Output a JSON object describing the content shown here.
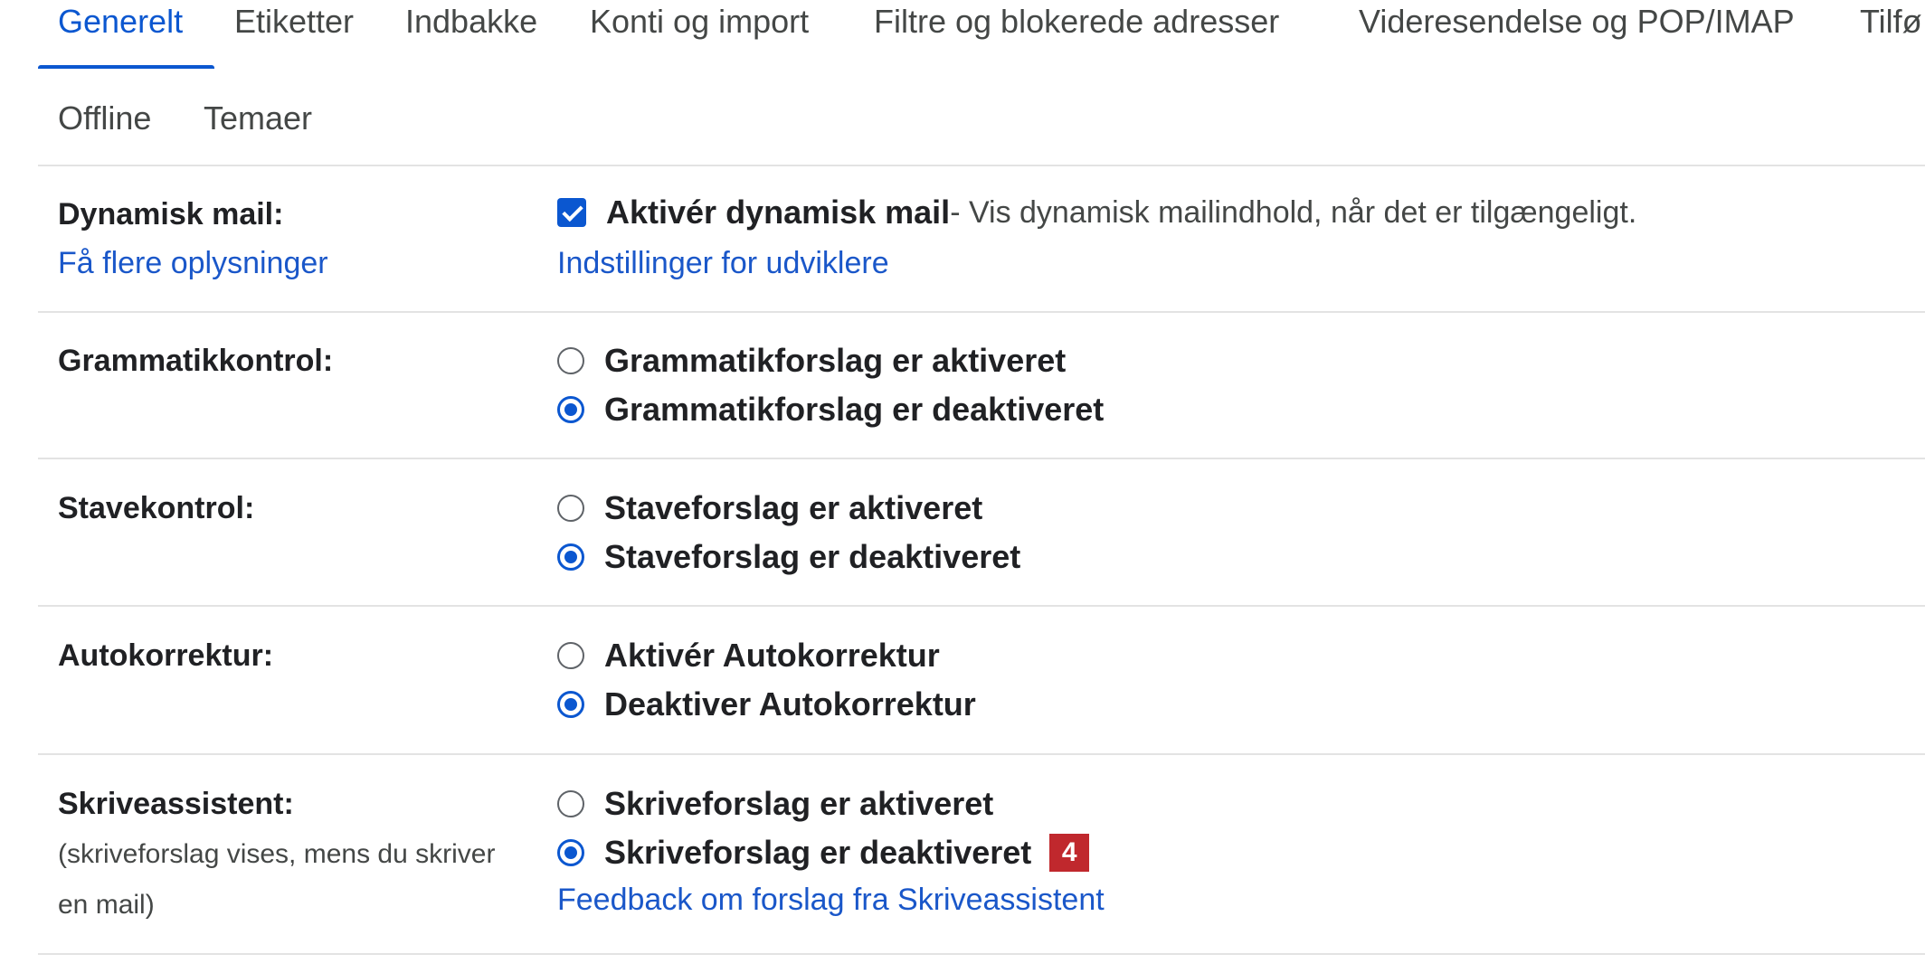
{
  "tabs": [
    "Generelt",
    "Etiketter",
    "Indbakke",
    "Konti og import",
    "Filtre og blokerede adresser",
    "Videresendelse og POP/IMAP",
    "Tilfø"
  ],
  "tabs_row2": [
    "Offline",
    "Temaer"
  ],
  "active_tab": "Generelt",
  "colors": {
    "accent": "#0b57d0",
    "link": "#1a57c9",
    "badge": "#c0282d"
  },
  "dynamic_mail": {
    "label": "Dynamisk mail:",
    "more_info": "Få flere oplysninger",
    "checkbox_label": "Aktivér dynamisk mail",
    "checkbox_desc": " - Vis dynamisk mailindhold, når det er tilgængeligt.",
    "checked": true,
    "dev_link": "Indstillinger for udviklere"
  },
  "grammar": {
    "label": "Grammatikkontrol:",
    "options": [
      "Grammatikforslag er aktiveret",
      "Grammatikforslag er deaktiveret"
    ],
    "selected": 1
  },
  "spelling": {
    "label": "Stavekontrol:",
    "options": [
      "Staveforslag er aktiveret",
      "Staveforslag er deaktiveret"
    ],
    "selected": 1
  },
  "autocorrect": {
    "label": "Autokorrektur:",
    "options": [
      "Aktivér Autokorrektur",
      "Deaktiver Autokorrektur"
    ],
    "selected": 1
  },
  "smart_compose": {
    "label": "Skriveassistent:",
    "note_line1": "(skriveforslag vises, mens du skriver",
    "note_line2": "en mail)",
    "options": [
      "Skriveforslag er aktiveret",
      "Skriveforslag er deaktiveret"
    ],
    "selected": 1,
    "badge": "4",
    "feedback_link": "Feedback om forslag fra Skriveassistent"
  }
}
